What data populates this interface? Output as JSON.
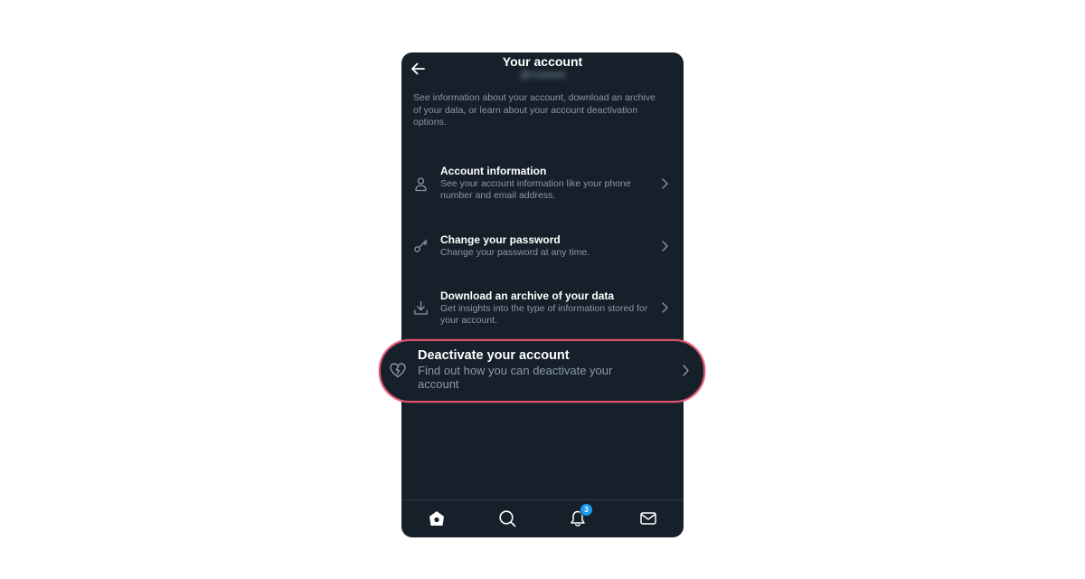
{
  "header": {
    "title": "Your account",
    "handle": "@masked"
  },
  "description": "See information about your account, download an archive of your data, or learn about your account deactivation options.",
  "menu": [
    {
      "title": "Account information",
      "subtitle": "See your account information like your phone number and email address.",
      "icon": "person-icon"
    },
    {
      "title": "Change your password",
      "subtitle": "Change your password at any time.",
      "icon": "key-icon"
    },
    {
      "title": "Download an archive of your data",
      "subtitle": "Get insights into the type of information stored for your account.",
      "icon": "download-icon"
    },
    {
      "title": "Deactivate your account",
      "subtitle": "Find out how you can deactivate your account",
      "icon": "broken-heart-icon"
    }
  ],
  "bottom_nav": {
    "notifications_badge": "3"
  },
  "colors": {
    "background": "#15202b",
    "text_primary": "#ffffff",
    "text_secondary": "#8b98a5",
    "highlight_border": "#e0556e",
    "badge": "#1d9bf0"
  }
}
